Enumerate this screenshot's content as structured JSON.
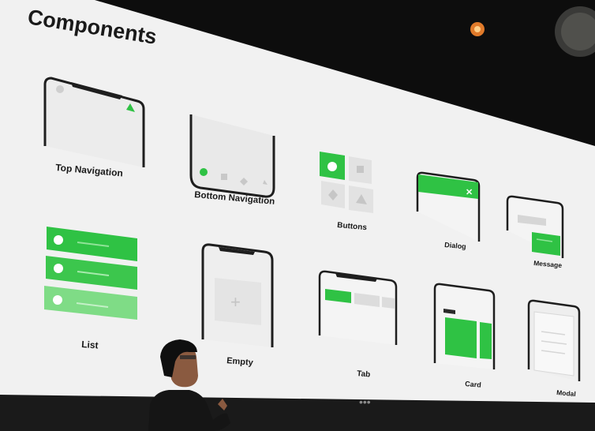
{
  "slide": {
    "title": "Components",
    "pagination_dots": "•••"
  },
  "components": {
    "top_navigation": "Top Navigation",
    "bottom_navigation": "Bottom Navigation",
    "buttons": "Buttons",
    "dialog": "Dialog",
    "message": "Message",
    "list": "List",
    "empty": "Empty",
    "tab": "Tab",
    "card": "Card",
    "modal": "Modal"
  },
  "colors": {
    "accent_green": "#2fc244",
    "light_green": "#7fdc86",
    "screen_bg": "#f2f2f2",
    "placeholder_gray": "#dcdcdc",
    "frame_dark": "#1e1e1e"
  }
}
